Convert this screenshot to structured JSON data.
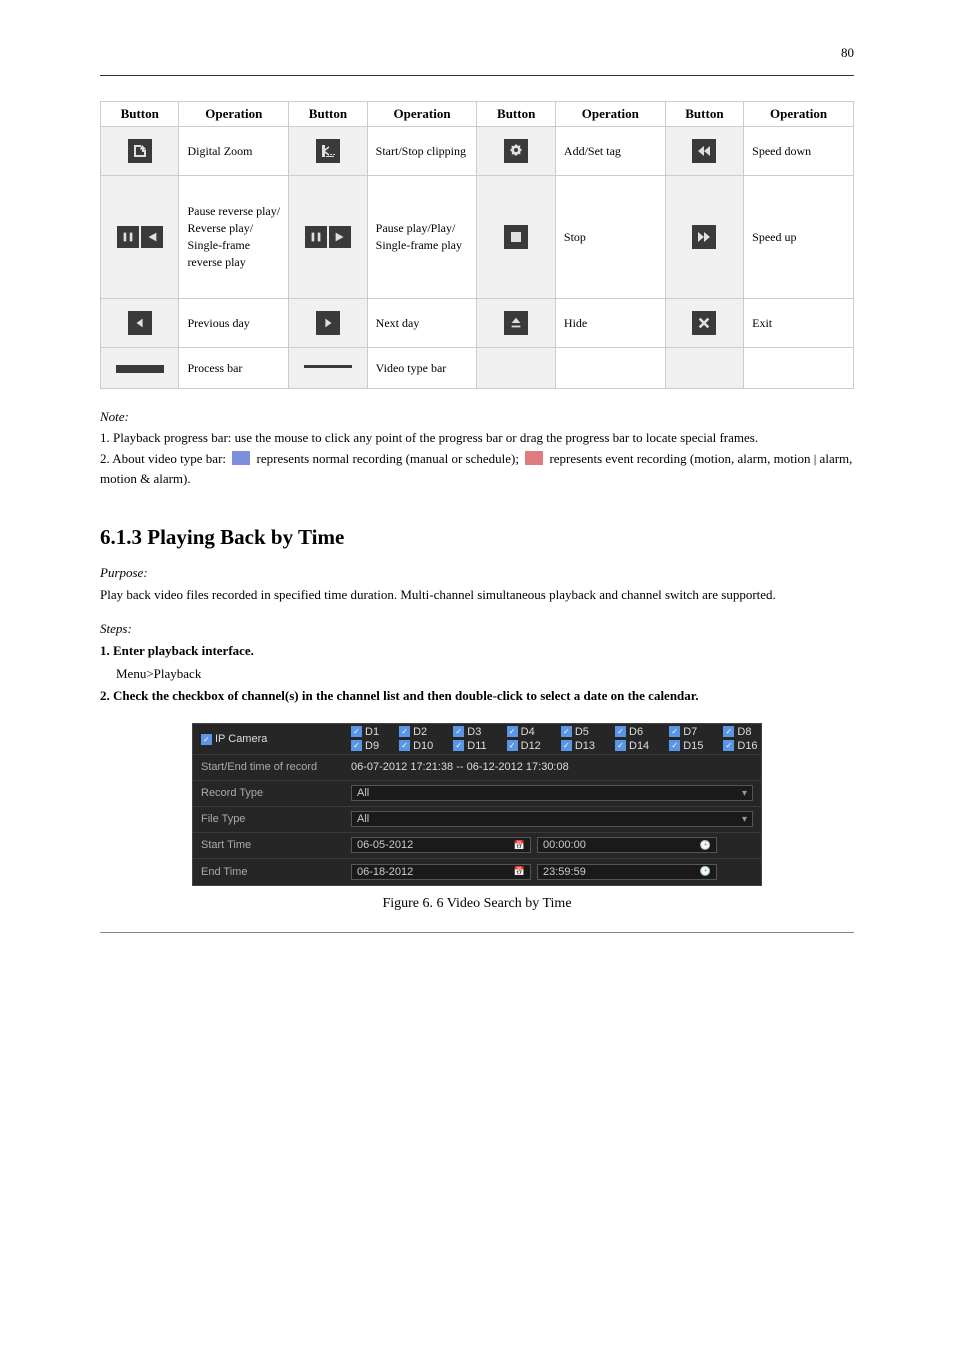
{
  "pageNumber": "80",
  "iconHeader": {
    "button": "Button",
    "operation": "Operation"
  },
  "iconRows": [
    [
      {
        "icon": "zoom",
        "desc": "Digital Zoom"
      },
      {
        "icon": "clip",
        "desc": "Start/Stop clipping"
      },
      {
        "icon": "tag",
        "desc": "Add/Set tag"
      },
      {
        "icon": "rewind",
        "desc": "Speed down"
      }
    ],
    [
      {
        "icon": "pauseprev",
        "desc": "Pause reverse play/\nReverse play/\nSingle-frame\nreverse play"
      },
      {
        "icon": "pauseplay",
        "desc": "Pause play/Play/\nSingle-frame play"
      },
      {
        "icon": "stop",
        "desc": "Stop"
      },
      {
        "icon": "fwd",
        "desc": "Speed up"
      }
    ],
    [
      {
        "icon": "prev",
        "desc": "Previous day"
      },
      {
        "icon": "next",
        "desc": "Next day"
      },
      {
        "icon": "hide",
        "desc": "Hide"
      },
      {
        "icon": "exit",
        "desc": "Exit"
      }
    ],
    [
      {
        "icon": "progressFull",
        "desc": "Process bar"
      },
      {
        "icon": "progressHalf",
        "desc": "Video type bar"
      },
      {
        "icon": "",
        "desc": ""
      },
      {
        "icon": "",
        "desc": ""
      }
    ]
  ],
  "notes": {
    "heading": "Note:",
    "line1": "1. Playback progress bar: use the mouse to click any point of the progress bar or drag the progress bar to locate special frames.",
    "line2_prefix": "2. About video type bar: ",
    "line2_normal": " represents normal recording (manual or schedule); ",
    "line2_event": " represents event recording (motion, alarm, motion | alarm, motion & alarm)."
  },
  "section": {
    "heading": "6.1.3 Playing Back by Time",
    "purposeLabel": "Purpose:",
    "purposeText": "Play back video files recorded in specified time duration. Multi-channel simultaneous playback and channel switch are supported.",
    "stepsLabel": "Steps:",
    "step1": "1. Enter playback interface.",
    "step1Path": "Menu>Playback",
    "step2": "2. Check the checkbox of channel(s) in the channel list and then double-click to select a date on the calendar."
  },
  "searchPanel": {
    "ipCamera": "IP Camera",
    "channels": [
      "D1",
      "D2",
      "D3",
      "D4",
      "D5",
      "D6",
      "D7",
      "D8",
      "D9",
      "D10",
      "D11",
      "D12",
      "D13",
      "D14",
      "D15",
      "D16"
    ],
    "startEndLabel": "Start/End time of record",
    "startEndValue": "06-07-2012 17:21:38 -- 06-12-2012 17:30:08",
    "recordTypeLabel": "Record Type",
    "recordTypeValue": "All",
    "fileTypeLabel": "File Type",
    "fileTypeValue": "All",
    "startTimeLabel": "Start Time",
    "startTimeDate": "06-05-2012",
    "startTimeTime": "00:00:00",
    "endTimeLabel": "End Time",
    "endTimeDate": "06-18-2012",
    "endTimeTime": "23:59:59"
  },
  "figureCaption": "Figure 6. 6  Video Search by Time"
}
